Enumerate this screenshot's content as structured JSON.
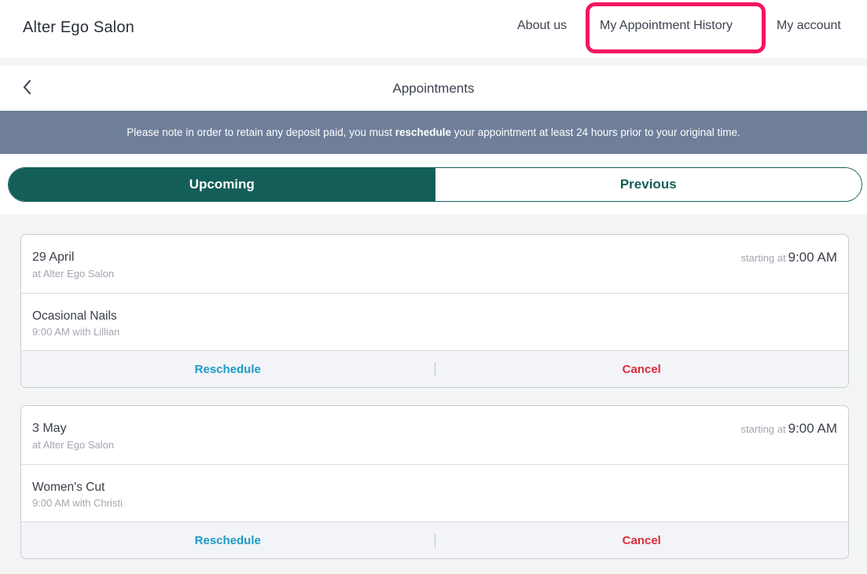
{
  "header": {
    "brand": "Alter Ego Salon",
    "nav": {
      "about": "About us",
      "history": "My Appointment History",
      "account": "My account"
    },
    "highlight_color": "#f3165f"
  },
  "subheader": {
    "title": "Appointments",
    "back_icon": "chevron-left-icon"
  },
  "notice": {
    "before": "Please note in order to retain any deposit paid, you must ",
    "bold": "reschedule",
    "after": " your appointment at least 24 hours prior to your original time."
  },
  "tabs": {
    "upcoming": "Upcoming",
    "previous": "Previous",
    "active": "Upcoming",
    "accent": "#135e58"
  },
  "appointments": [
    {
      "date": "29 April",
      "location": "at Alter Ego Salon",
      "starting_label": "starting at",
      "time": "9:00 AM",
      "service": "Ocasional Nails",
      "detail": "9:00 AM with Lillian",
      "reschedule": "Reschedule",
      "cancel": "Cancel"
    },
    {
      "date": "3 May",
      "location": "at Alter Ego Salon",
      "starting_label": "starting at",
      "time": "9:00 AM",
      "service": "Women's Cut",
      "detail": "9:00 AM with Christi",
      "reschedule": "Reschedule",
      "cancel": "Cancel"
    }
  ]
}
